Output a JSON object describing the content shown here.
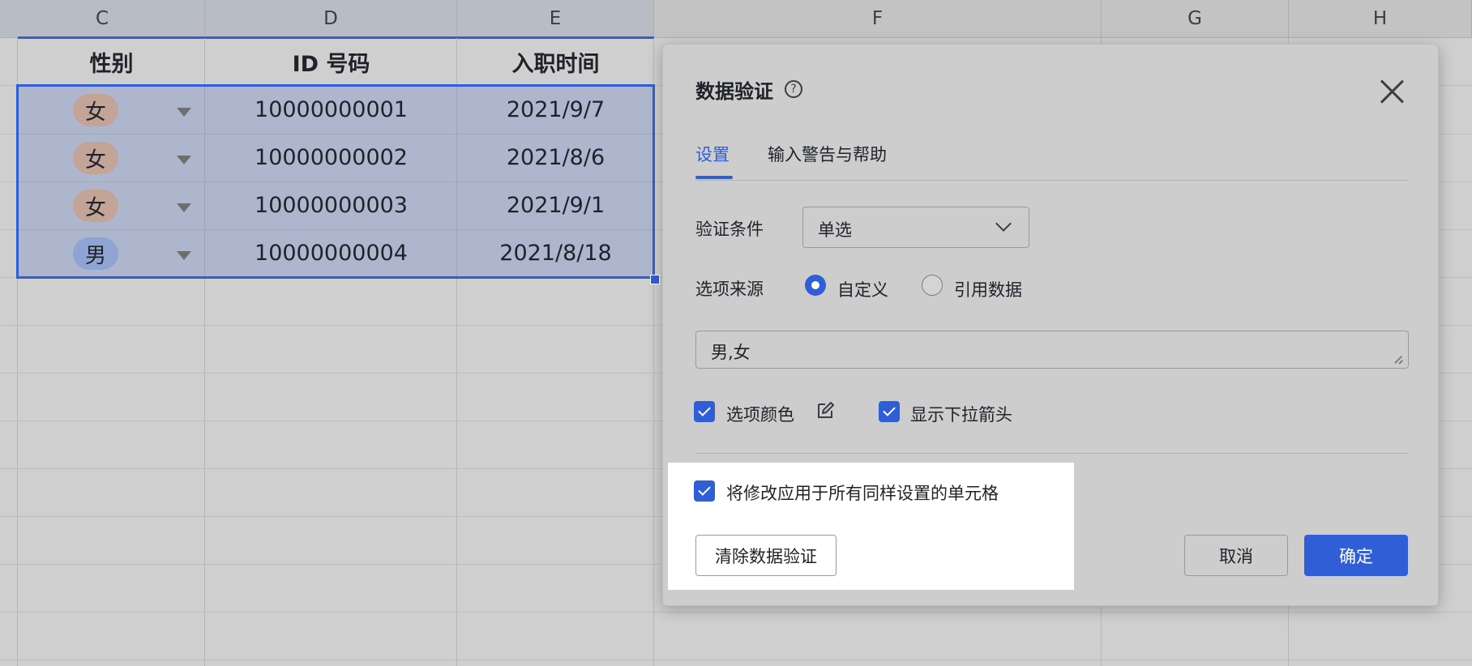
{
  "columns": [
    "C",
    "D",
    "E",
    "F",
    "G",
    "H"
  ],
  "table": {
    "headers": [
      "性别",
      "ID 号码",
      "入职时间"
    ],
    "rows": [
      {
        "gender": "女",
        "id": "10000000001",
        "date": "2021/9/7"
      },
      {
        "gender": "女",
        "id": "10000000002",
        "date": "2021/8/6"
      },
      {
        "gender": "女",
        "id": "10000000003",
        "date": "2021/9/1"
      },
      {
        "gender": "男",
        "id": "10000000004",
        "date": "2021/8/18"
      }
    ]
  },
  "colors": {
    "accent": "#2f5ed6",
    "tag_female": "#c3a597",
    "tag_male": "#8fa4d3"
  },
  "dialog": {
    "title": "数据验证",
    "help_icon": "question-circle-icon",
    "tabs": [
      {
        "label": "设置",
        "active": true
      },
      {
        "label": "输入警告与帮助",
        "active": false
      }
    ],
    "condition_label": "验证条件",
    "condition_value": "单选",
    "source_label": "选项来源",
    "source_options": [
      {
        "label": "自定义",
        "selected": true
      },
      {
        "label": "引用数据",
        "selected": false
      }
    ],
    "options_text": "男,女",
    "option_color_label": "选项颜色",
    "show_arrow_label": "显示下拉箭头",
    "apply_all_label": "将修改应用于所有同样设置的单元格",
    "clear_button": "清除数据验证",
    "cancel_button": "取消",
    "confirm_button": "确定"
  }
}
